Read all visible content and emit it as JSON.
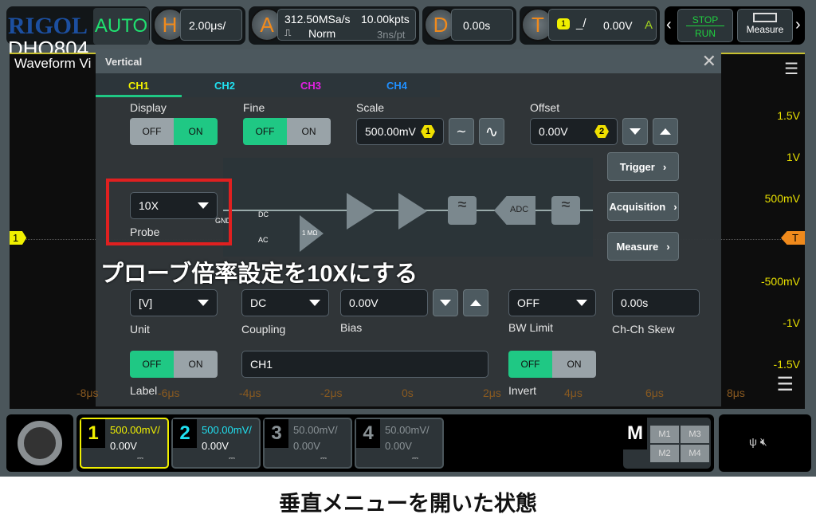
{
  "brand": {
    "logo": "RIGOL",
    "model": "DHO804",
    "view": "Waveform Vi"
  },
  "top": {
    "mode": "AUTO",
    "h_letter": "H",
    "h_value": "2.00μs/",
    "a_letter": "A",
    "sample_rate": "312.50MSa/s",
    "memory": "10.00kpts",
    "acq_mode": "Norm",
    "resolution": "3ns/pt",
    "d_letter": "D",
    "delay": "0.00s",
    "t_letter": "T",
    "trig_source": "1",
    "trig_level": "0.00V",
    "trig_mode": "A",
    "stop": "STOP",
    "run": "RUN",
    "measure": "Measure"
  },
  "axis": {
    "y": [
      "1.5V",
      "1V",
      "500mV",
      "-500mV",
      "-1V",
      "-1.5V"
    ],
    "x": [
      "-8μs",
      "-6μs",
      "-4μs",
      "-2μs",
      "0s",
      "2μs",
      "4μs",
      "6μs",
      "8μs"
    ],
    "ch_marker": "1",
    "trig_marker": "T"
  },
  "dialog": {
    "title": "Vertical",
    "tabs": [
      {
        "label": "CH1",
        "color": "#f0f000"
      },
      {
        "label": "CH2",
        "color": "#20e0f0"
      },
      {
        "label": "CH3",
        "color": "#e020e0"
      },
      {
        "label": "CH4",
        "color": "#2090ff"
      }
    ],
    "display": {
      "label": "Display",
      "off": "OFF",
      "on": "ON",
      "state": "ON"
    },
    "fine": {
      "label": "Fine",
      "off": "OFF",
      "on": "ON",
      "state": "OFF"
    },
    "scale": {
      "label": "Scale",
      "value": "500.00mV",
      "knob": "1"
    },
    "offset": {
      "label": "Offset",
      "value": "0.00V",
      "knob": "2"
    },
    "probe": {
      "label": "Probe",
      "value": "10X"
    },
    "diagram": {
      "gnd": "GND",
      "dc": "DC",
      "ac": "AC",
      "imp": "1 MΩ",
      "adc": "ADC"
    },
    "nav": [
      "Trigger",
      "Acquisition",
      "Measure"
    ],
    "unit": {
      "label": "Unit",
      "value": "[V]"
    },
    "coupling": {
      "label": "Coupling",
      "value": "DC"
    },
    "bias": {
      "label": "Bias",
      "value": "0.00V"
    },
    "bw": {
      "label": "BW Limit",
      "value": "OFF"
    },
    "skew": {
      "label": "Ch-Ch Skew",
      "value": "0.00s"
    },
    "label_t": {
      "label": "Label",
      "off": "OFF",
      "on": "ON",
      "state": "OFF"
    },
    "label_text": "CH1",
    "invert": {
      "label": "Invert",
      "off": "OFF",
      "on": "ON",
      "state": "OFF"
    }
  },
  "annotation": "プローブ倍率設定を10Xにする",
  "channels": [
    {
      "n": "1",
      "scale": "500.00mV/",
      "offset": "0.00V",
      "color": "#f0f000"
    },
    {
      "n": "2",
      "scale": "500.00mV/",
      "offset": "0.00V",
      "color": "#20e0f0"
    },
    {
      "n": "3",
      "scale": "50.00mV/",
      "offset": "0.00V",
      "color": "#8a9296"
    },
    {
      "n": "4",
      "scale": "50.00mV/",
      "offset": "0.00V",
      "color": "#8a9296"
    }
  ],
  "math": {
    "letter": "M",
    "items": [
      "M1",
      "M3",
      "M2",
      "M4"
    ]
  },
  "caption": "垂直メニューを開いた状態",
  "highlight_color": "#e02020"
}
